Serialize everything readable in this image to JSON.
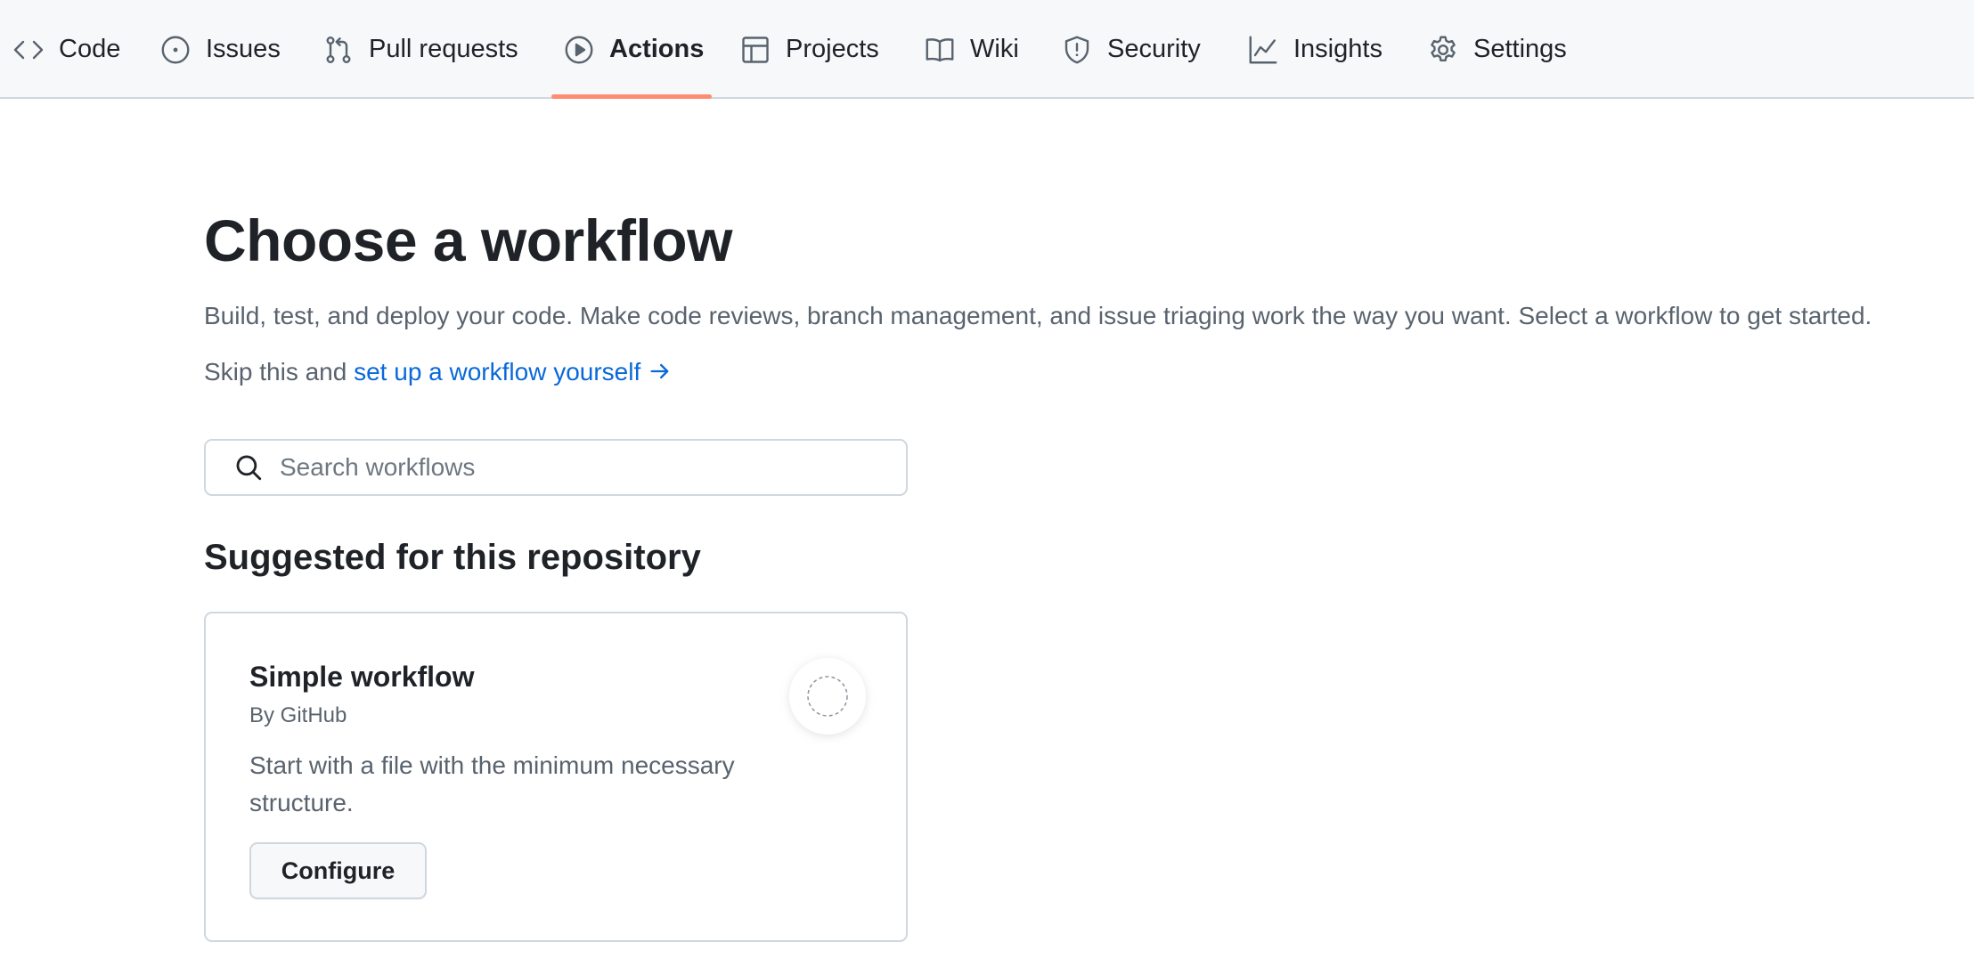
{
  "nav": {
    "tabs": [
      {
        "label": "Code",
        "icon": "code-icon"
      },
      {
        "label": "Issues",
        "icon": "issue-icon"
      },
      {
        "label": "Pull requests",
        "icon": "pull-request-icon"
      },
      {
        "label": "Actions",
        "icon": "play-icon",
        "active": true
      },
      {
        "label": "Projects",
        "icon": "table-icon"
      },
      {
        "label": "Wiki",
        "icon": "book-icon"
      },
      {
        "label": "Security",
        "icon": "shield-icon"
      },
      {
        "label": "Insights",
        "icon": "graph-icon"
      },
      {
        "label": "Settings",
        "icon": "gear-icon"
      }
    ],
    "active_underline_color": "#fd8c73"
  },
  "main": {
    "title": "Choose a workflow",
    "subtitle": "Build, test, and deploy your code. Make code reviews, branch management, and issue triaging work the way you want. Select a workflow to get started.",
    "skip_prefix": "Skip this and",
    "skip_link": "set up a workflow yourself",
    "skip_arrow_icon": "arrow-right-icon",
    "link_color": "#0969da"
  },
  "search": {
    "placeholder": "Search workflows",
    "value": "",
    "icon": "search-icon"
  },
  "suggested": {
    "heading": "Suggested for this repository",
    "cards": [
      {
        "title": "Simple workflow",
        "author": "By GitHub",
        "description": "Start with a file with the minimum necessary structure.",
        "button_label": "Configure",
        "logo_icon": "dashed-circle-icon"
      }
    ]
  }
}
